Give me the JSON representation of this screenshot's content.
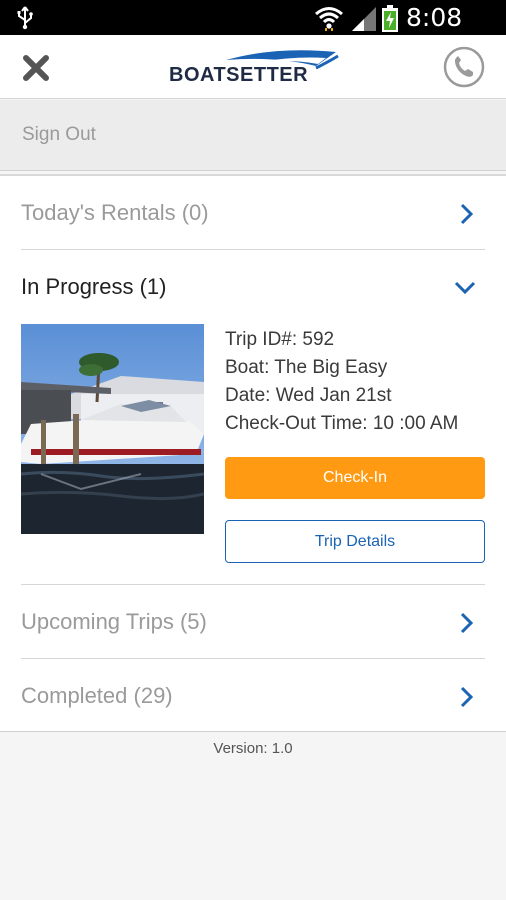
{
  "status_bar": {
    "time": "8:08 PM",
    "icons": [
      "usb-icon",
      "wifi-icon",
      "signal-icon",
      "battery-charging-icon"
    ]
  },
  "app_bar": {
    "logo_text": "BOATSETTER",
    "close_icon": "close-x-icon",
    "phone_icon": "phone-icon"
  },
  "menu": {
    "sign_out": "Sign Out"
  },
  "sections": {
    "todays_rentals": "Today's Rentals (0)",
    "in_progress": "In Progress (1)",
    "upcoming": "Upcoming Trips (5)",
    "completed": "Completed (29)"
  },
  "trip": {
    "trip_id": "Trip ID#: 592",
    "boat": "Boat: The Big Easy",
    "date": "Date: Wed Jan 21st",
    "checkout": "Check-Out Time: 10 :00 AM",
    "checkin_label": "Check-In",
    "details_label": "Trip Details"
  },
  "footer": {
    "version": "Version: 1.0"
  },
  "colors": {
    "accent_blue": "#1b63b5",
    "checkin_orange": "#ff9a12",
    "muted_text": "#9a9a9a"
  }
}
